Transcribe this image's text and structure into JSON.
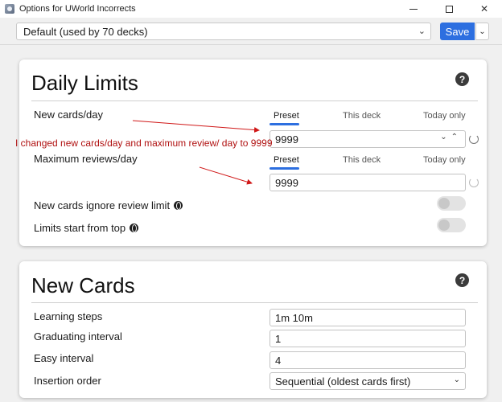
{
  "window": {
    "title": "Options for UWorld Incorrects",
    "close_glyph": "✕"
  },
  "toolbar": {
    "preset_value": "Default (used by 70 decks)",
    "save_label": "Save",
    "menu_glyph": "⌄"
  },
  "daily_limits": {
    "title": "Daily Limits",
    "help_glyph": "?",
    "tabs": [
      "Preset",
      "This deck",
      "Today only"
    ],
    "new_cards": {
      "label": "New cards/day",
      "value": "9999"
    },
    "max_reviews": {
      "label": "Maximum reviews/day",
      "value": "9999"
    },
    "ignore_review_limit": {
      "label": "New cards ignore review limit",
      "enabled": false
    },
    "limits_from_top": {
      "label": "Limits start from top",
      "enabled": false
    }
  },
  "new_cards": {
    "title": "New Cards",
    "help_glyph": "?",
    "learning_steps": {
      "label": "Learning steps",
      "value": "1m 10m"
    },
    "graduating_interval": {
      "label": "Graduating interval",
      "value": "1"
    },
    "easy_interval": {
      "label": "Easy interval",
      "value": "4"
    },
    "insertion_order": {
      "label": "Insertion order",
      "value": "Sequential (oldest cards first)"
    }
  },
  "annotation": {
    "text": "I changed new cards/day and maximum review/ day  to 9999",
    "color": "#b01010"
  },
  "colors": {
    "accent": "#2d6fe0"
  },
  "icons": [
    "app-icon",
    "minimize-icon",
    "maximize-icon",
    "close-icon",
    "chevron-down-icon",
    "help-icon",
    "reset-icon",
    "globe-icon"
  ]
}
